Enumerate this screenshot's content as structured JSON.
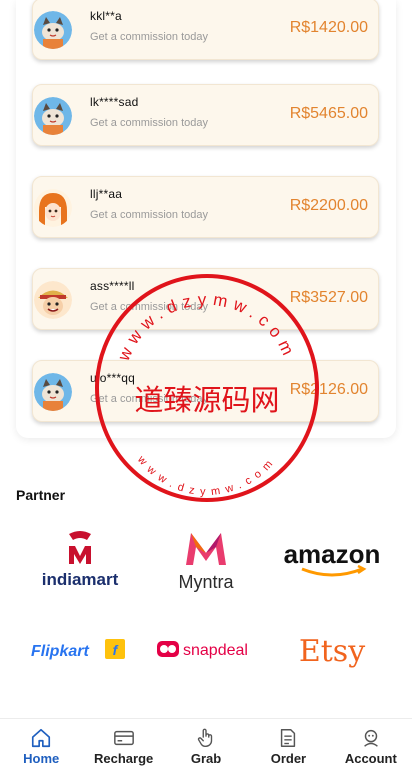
{
  "commissions": [
    {
      "name": "kkl**a",
      "subtitle": "Get a commission today",
      "amount": "R$1420.00",
      "avatar": "cat-avatar"
    },
    {
      "name": "lk****sad",
      "subtitle": "Get a commission today",
      "amount": "R$5465.00",
      "avatar": "cat-avatar"
    },
    {
      "name": "llj**aa",
      "subtitle": "Get a commission today",
      "amount": "R$2200.00",
      "avatar": "anime-girl-avatar"
    },
    {
      "name": "ass****ll",
      "subtitle": "Get a commission today",
      "amount": "R$3527.00",
      "avatar": "pirate-avatar"
    },
    {
      "name": "uio***qq",
      "subtitle": "Get a commission today",
      "amount": "R$2126.00",
      "avatar": "cat-avatar"
    }
  ],
  "partner": {
    "title": "Partner",
    "logos": [
      {
        "name": "indiamart",
        "text": "indiamart"
      },
      {
        "name": "Myntra",
        "text": "Myntra"
      },
      {
        "name": "amazon",
        "text": "amazon"
      },
      {
        "name": "Flipkart",
        "text": "Flipkart"
      },
      {
        "name": "snapdeal",
        "text": "snapdeal"
      },
      {
        "name": "Etsy",
        "text": "Etsy"
      }
    ]
  },
  "watermark": {
    "center_text": "道臻源码网",
    "ring_text": "www.dzymw.com"
  },
  "nav": {
    "items": [
      {
        "label": "Home",
        "icon": "home-icon",
        "active": true
      },
      {
        "label": "Recharge",
        "icon": "card-icon",
        "active": false
      },
      {
        "label": "Grab",
        "icon": "hand-icon",
        "active": false
      },
      {
        "label": "Order",
        "icon": "document-icon",
        "active": false
      },
      {
        "label": "Account",
        "icon": "user-icon",
        "active": false
      }
    ]
  },
  "colors": {
    "amount": "#e2842f",
    "card_bg": "#fdf7ec",
    "nav_active": "#1f5fbf",
    "watermark": "#e0141b"
  }
}
